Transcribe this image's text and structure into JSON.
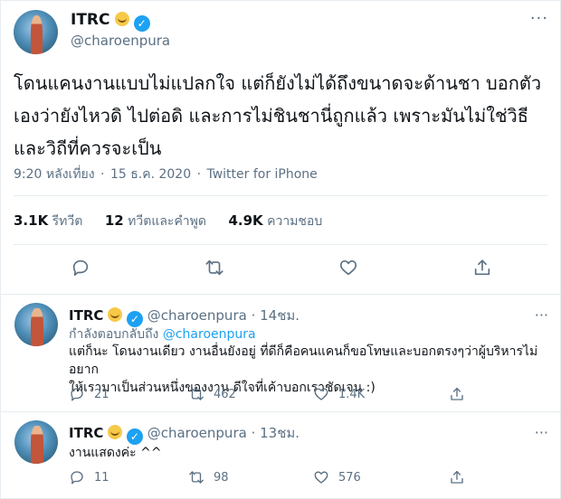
{
  "main": {
    "name": "ITRC",
    "handle": "@charoenpura",
    "text_lines": [
      "โดนแคนงานแบบไม่แปลกใจ แต่ก็ยังไม่ได้ถึงขนาดจะด้านชา บอกตัว",
      "เองว่ายังไหวดิ ไปต่อดิ และการไม่ชินชานี่ถูกแล้ว เพราะมันไม่ใช่วิธี",
      "และวิถีที่ควรจะเป็น"
    ],
    "time": "9:20 หลังเที่ยง",
    "dot": "·",
    "date": "15 ธ.ค. 2020",
    "source": "Twitter for iPhone",
    "retweets_count": "3.1K",
    "retweets_label": "รีทวีต",
    "quotes_count": "12",
    "quotes_label": "ทวีตและคำพูด",
    "likes_count": "4.9K",
    "likes_label": "ความชอบ",
    "more": "···"
  },
  "replies": [
    {
      "name": "ITRC",
      "handle": "@charoenpura",
      "time": "· 14ชม.",
      "replying_prefix": "กำลังตอบกลับถึง",
      "replying_handle": "@charoenpura",
      "text_lines": [
        "แต่ก็นะ โดนงานเดียว งานอื่นยังอยู่ ที่ดีก็คือคนแคนก็ขอโทษและบอกตรงๆว่าผู้บริหารไม่อยาก",
        "ให้เรามาเป็นส่วนหนึ่งของงาน ดีใจที่เค้าบอกเราชัดเจน :)"
      ],
      "reply_count": "21",
      "retweet_count": "462",
      "like_count": "1.4K",
      "more": "···"
    },
    {
      "name": "ITRC",
      "handle": "@charoenpura",
      "time": "· 13ชม.",
      "text_lines": [
        "งานแสดงค่ะ ^^"
      ],
      "reply_count": "11",
      "retweet_count": "98",
      "like_count": "576",
      "more": "···"
    }
  ],
  "icons": {
    "verified": "verified-badge",
    "emoji": "smirking-cat-emoji",
    "reply": "reply-icon",
    "retweet": "retweet-icon",
    "like": "heart-icon",
    "share": "share-icon"
  },
  "colors": {
    "accent": "#1da1f2",
    "secondary_text": "#5b7083",
    "text": "#0f1419",
    "divider": "#e6ecf0"
  }
}
